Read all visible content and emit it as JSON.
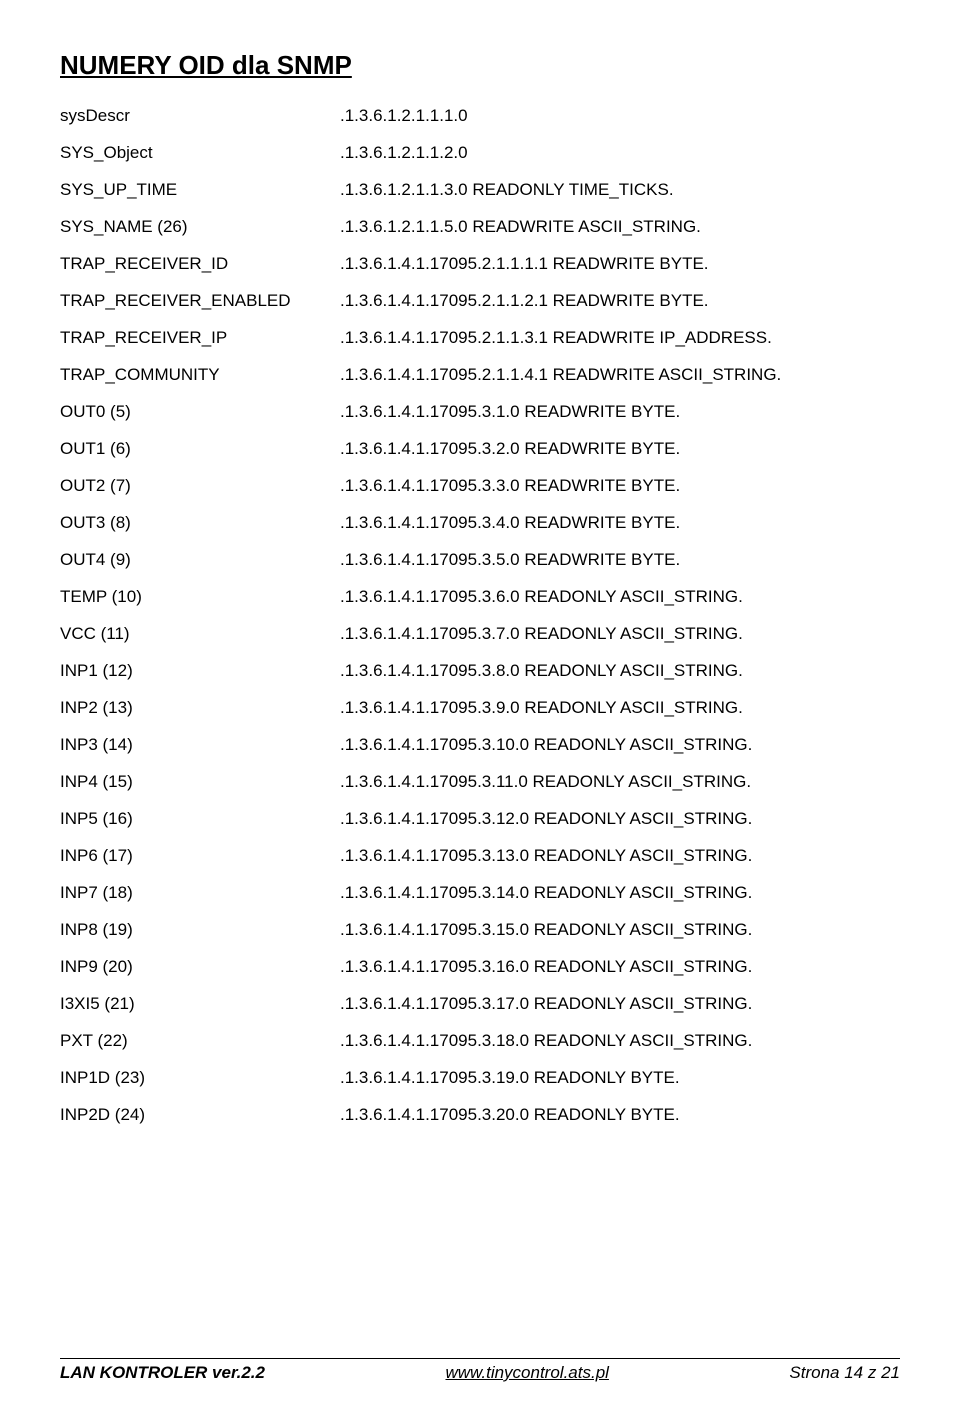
{
  "title": "NUMERY OID dla SNMP",
  "rows": [
    {
      "label": "sysDescr",
      "value": ".1.3.6.1.2.1.1.1.0"
    },
    {
      "label": "SYS_Object",
      "value": ".1.3.6.1.2.1.1.2.0"
    },
    {
      "label": "SYS_UP_TIME",
      "value": ".1.3.6.1.2.1.1.3.0 READONLY TIME_TICKS."
    },
    {
      "label": "SYS_NAME (26)",
      "value": ".1.3.6.1.2.1.1.5.0 READWRITE ASCII_STRING."
    },
    {
      "label": "TRAP_RECEIVER_ID",
      "value": ".1.3.6.1.4.1.17095.2.1.1.1.1 READWRITE BYTE."
    },
    {
      "label": "TRAP_RECEIVER_ENABLED",
      "value": ".1.3.6.1.4.1.17095.2.1.1.2.1 READWRITE BYTE."
    },
    {
      "label": "TRAP_RECEIVER_IP",
      "value": ".1.3.6.1.4.1.17095.2.1.1.3.1 READWRITE IP_ADDRESS."
    },
    {
      "label": "TRAP_COMMUNITY",
      "value": ".1.3.6.1.4.1.17095.2.1.1.4.1 READWRITE ASCII_STRING."
    },
    {
      "label": "OUT0 (5)",
      "value": ".1.3.6.1.4.1.17095.3.1.0 READWRITE BYTE."
    },
    {
      "label": "OUT1 (6)",
      "value": ".1.3.6.1.4.1.17095.3.2.0 READWRITE BYTE."
    },
    {
      "label": "OUT2 (7)",
      "value": ".1.3.6.1.4.1.17095.3.3.0 READWRITE BYTE."
    },
    {
      "label": "OUT3 (8)",
      "value": ".1.3.6.1.4.1.17095.3.4.0 READWRITE BYTE."
    },
    {
      "label": "OUT4 (9)",
      "value": ".1.3.6.1.4.1.17095.3.5.0 READWRITE BYTE."
    },
    {
      "label": "TEMP (10)",
      "value": ".1.3.6.1.4.1.17095.3.6.0 READONLY ASCII_STRING."
    },
    {
      "label": "VCC (11)",
      "value": ".1.3.6.1.4.1.17095.3.7.0 READONLY ASCII_STRING."
    },
    {
      "label": "INP1 (12)",
      "value": ".1.3.6.1.4.1.17095.3.8.0 READONLY ASCII_STRING."
    },
    {
      "label": "INP2 (13)",
      "value": ".1.3.6.1.4.1.17095.3.9.0 READONLY ASCII_STRING."
    },
    {
      "label": "INP3 (14)",
      "value": ".1.3.6.1.4.1.17095.3.10.0 READONLY ASCII_STRING."
    },
    {
      "label": "INP4 (15)",
      "value": ".1.3.6.1.4.1.17095.3.11.0 READONLY ASCII_STRING."
    },
    {
      "label": "INP5 (16)",
      "value": ".1.3.6.1.4.1.17095.3.12.0 READONLY ASCII_STRING."
    },
    {
      "label": "INP6 (17)",
      "value": ".1.3.6.1.4.1.17095.3.13.0 READONLY ASCII_STRING."
    },
    {
      "label": "INP7 (18)",
      "value": ".1.3.6.1.4.1.17095.3.14.0 READONLY ASCII_STRING."
    },
    {
      "label": "INP8 (19)",
      "value": ".1.3.6.1.4.1.17095.3.15.0 READONLY ASCII_STRING."
    },
    {
      "label": "INP9 (20)",
      "value": ".1.3.6.1.4.1.17095.3.16.0 READONLY ASCII_STRING."
    },
    {
      "label": "I3XI5 (21)",
      "value": ".1.3.6.1.4.1.17095.3.17.0 READONLY ASCII_STRING."
    },
    {
      "label": "PXT (22)",
      "value": ".1.3.6.1.4.1.17095.3.18.0 READONLY ASCII_STRING."
    },
    {
      "label": "INP1D (23)",
      "value": ".1.3.6.1.4.1.17095.3.19.0 READONLY BYTE."
    },
    {
      "label": "INP2D (24)",
      "value": ".1.3.6.1.4.1.17095.3.20.0 READONLY BYTE."
    }
  ],
  "footer": {
    "left": "LAN KONTROLER  ver.2.2",
    "center": "www.tinycontrol.ats.pl",
    "right": "Strona 14 z 21"
  }
}
